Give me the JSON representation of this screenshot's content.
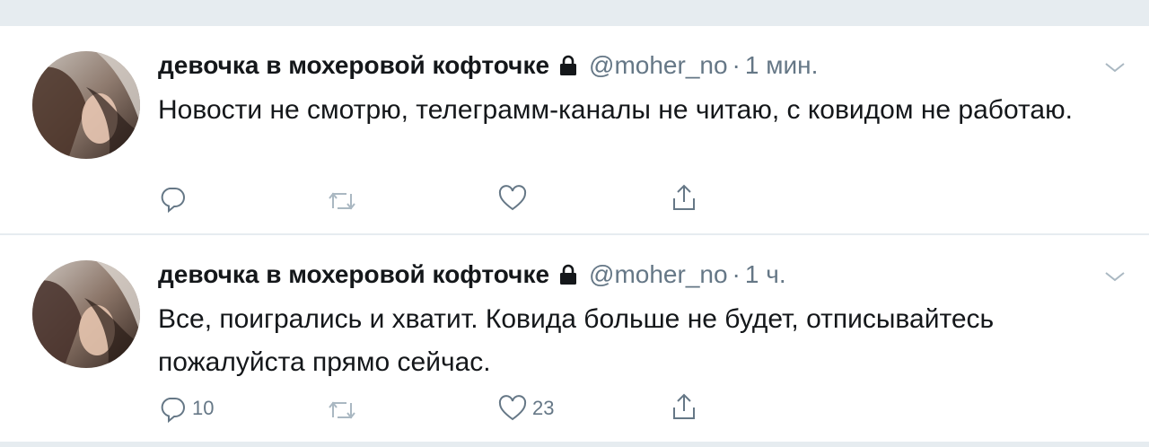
{
  "colors": {
    "background": "#e6ecf0",
    "card": "#ffffff",
    "text": "#14171a",
    "secondary": "#657786",
    "icon": "#657786"
  },
  "tweets": [
    {
      "display_name": "девочка в мохеровой кофточке",
      "handle": "@moher_no",
      "separator": "·",
      "time": "1 мин.",
      "text": "Новости не смотрю, телеграмм-каналы не читаю, с ковидом не работаю.",
      "reply_count": "",
      "like_count": "",
      "icons": [
        "lock-icon",
        "chevron-down-icon",
        "reply-icon",
        "retweet-icon",
        "like-icon",
        "share-icon"
      ]
    },
    {
      "display_name": "девочка в мохеровой кофточке",
      "handle": "@moher_no",
      "separator": "·",
      "time": "1 ч.",
      "text": "Все, поигрались и хватит. Ковида больше не будет, отписывайтесь пожалуйста прямо сейчас.",
      "reply_count": "10",
      "like_count": "23",
      "icons": [
        "lock-icon",
        "chevron-down-icon",
        "reply-icon",
        "retweet-icon",
        "like-icon",
        "share-icon"
      ]
    }
  ]
}
